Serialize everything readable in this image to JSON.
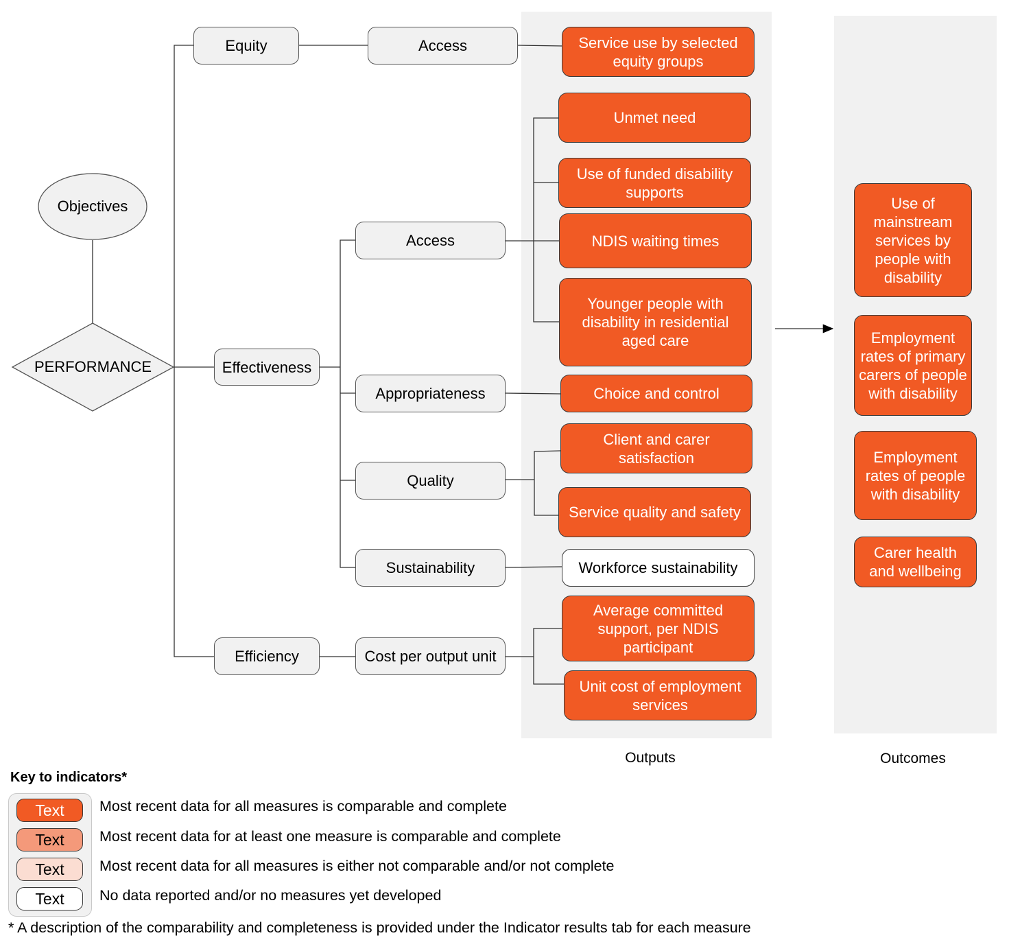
{
  "colors": {
    "complete": "#F15A24",
    "partial": "#F4997A",
    "incomplete": "#FBDDD2",
    "no_data": "#FFFFFF",
    "node_fill": "#F1F1F1",
    "panel_fill": "#F1F1F1"
  },
  "root": {
    "objectives": "Objectives",
    "performance": "PERFORMANCE"
  },
  "domains": {
    "equity": "Equity",
    "effectiveness": "Effectiveness",
    "efficiency": "Efficiency"
  },
  "subdomains": {
    "equity_access": "Access",
    "eff_access": "Access",
    "appropriateness": "Appropriateness",
    "quality": "Quality",
    "sustainability": "Sustainability",
    "cost": "Cost per output unit"
  },
  "outputs": {
    "label": "Outputs",
    "items": [
      {
        "text": "Service use by selected equity groups",
        "status": "complete"
      },
      {
        "text": "Unmet need",
        "status": "complete"
      },
      {
        "text": "Use of funded disability supports",
        "status": "complete"
      },
      {
        "text": "NDIS waiting times",
        "status": "complete"
      },
      {
        "text": "Younger people with disability in residential aged care",
        "status": "complete"
      },
      {
        "text": "Choice and control",
        "status": "complete"
      },
      {
        "text": "Client and carer satisfaction",
        "status": "complete"
      },
      {
        "text": "Service quality and safety",
        "status": "complete"
      },
      {
        "text": "Workforce sustainability",
        "status": "no_data"
      },
      {
        "text": "Average committed support, per NDIS participant",
        "status": "complete"
      },
      {
        "text": "Unit cost of employment services",
        "status": "complete"
      }
    ]
  },
  "outcomes": {
    "label": "Outcomes",
    "items": [
      {
        "text": "Use of mainstream services by people with disability",
        "status": "complete"
      },
      {
        "text": "Employment rates of primary carers of people with disability",
        "status": "complete"
      },
      {
        "text": "Employment rates of people with disability",
        "status": "complete"
      },
      {
        "text": "Carer health and wellbeing",
        "status": "complete"
      }
    ]
  },
  "key": {
    "title": "Key to indicators*",
    "items": [
      {
        "swatch": "Text",
        "description": "Most recent data for all measures is comparable and complete"
      },
      {
        "swatch": "Text",
        "description": "Most recent data for at least one measure is comparable and complete"
      },
      {
        "swatch": "Text",
        "description": "Most recent data for all measures is either not comparable and/or not complete"
      },
      {
        "swatch": "Text",
        "description": "No data reported and/or no measures yet developed"
      }
    ],
    "footnote": "* A description of the comparability and completeness is provided under the Indicator results tab for each measure"
  }
}
